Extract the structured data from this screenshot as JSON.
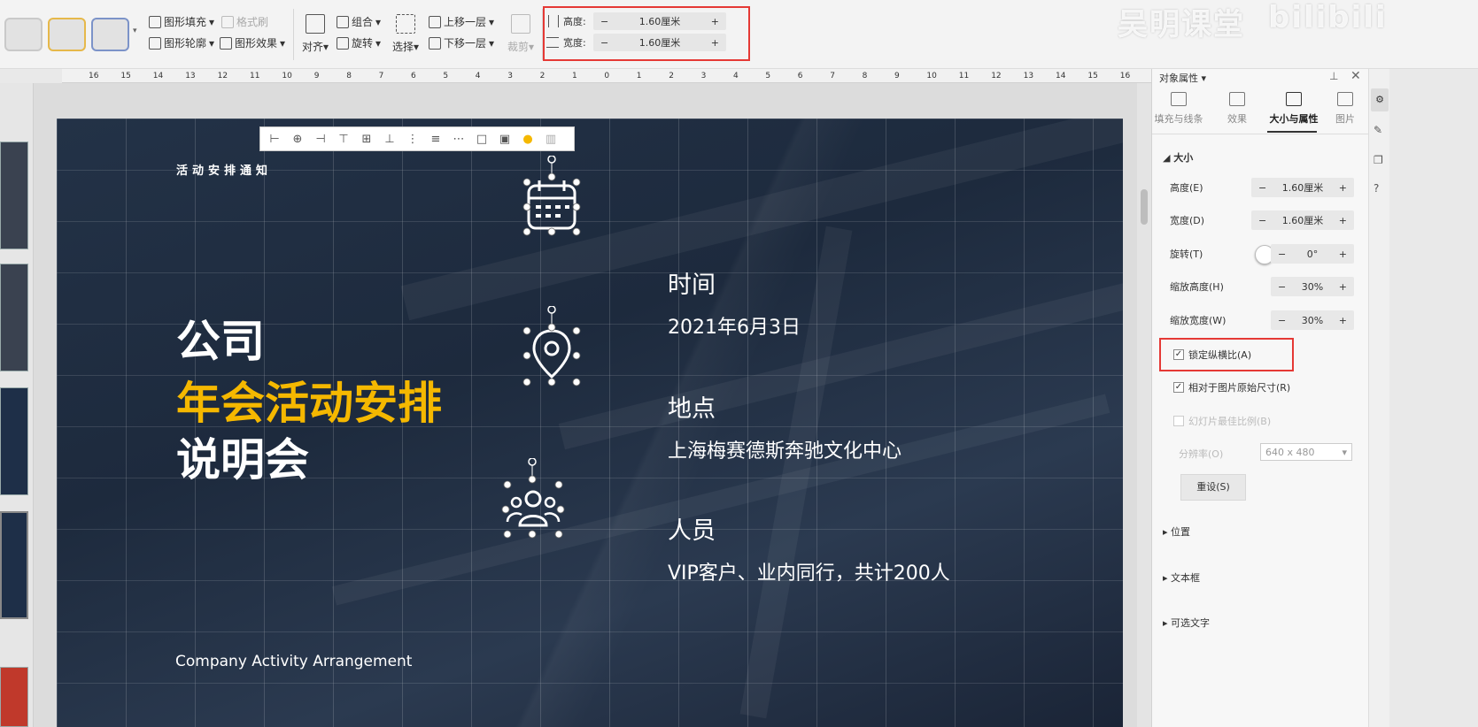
{
  "ribbon": {
    "shape_fill": "图形填充",
    "shape_outline": "图形轮廓",
    "format_painter": "格式刷",
    "shape_effect": "图形效果",
    "align": "对齐",
    "group": "组合",
    "rotate": "旋转",
    "select": "选择",
    "bring_forward": "上移一层",
    "send_backward": "下移一层",
    "crop": "裁剪",
    "height_label": "高度:",
    "height_value": "1.60厘米",
    "width_label": "宽度:",
    "width_value": "1.60厘米",
    "minus": "−",
    "plus": "+"
  },
  "watermark": {
    "text1": "吴明课堂",
    "text2": "bilibili"
  },
  "ruler": {
    "ticks": [
      "16",
      "15",
      "14",
      "13",
      "12",
      "11",
      "10",
      "9",
      "8",
      "7",
      "6",
      "5",
      "4",
      "3",
      "2",
      "1",
      "0",
      "1",
      "2",
      "3",
      "4",
      "5",
      "6",
      "7",
      "8",
      "9",
      "10",
      "11",
      "12",
      "13",
      "14",
      "15",
      "16"
    ]
  },
  "slide": {
    "eyebrow": "活动安排通知",
    "title_line1": "公司",
    "title_line2": "年会活动安排",
    "title_line3": "说明会",
    "footer": "Company Activity Arrangement",
    "time_heading": "时间",
    "time_value": "2021年6月3日",
    "place_heading": "地点",
    "place_value": "上海梅赛德斯奔驰文化中心",
    "people_heading": "人员",
    "people_value": "VIP客户、业内同行，共计200人",
    "accent_color": "#f5b800"
  },
  "panel": {
    "title": "对象属性",
    "tabs": [
      "填充与线条",
      "效果",
      "大小与属性",
      "图片"
    ],
    "active_tab": "大小与属性",
    "section_size": "大小",
    "height_label": "高度(E)",
    "height_value": "1.60厘米",
    "width_label": "宽度(D)",
    "width_value": "1.60厘米",
    "rotate_label": "旋转(T)",
    "rotate_value": "0°",
    "scale_h_label": "缩放高度(H)",
    "scale_h_value": "30%",
    "scale_w_label": "缩放宽度(W)",
    "scale_w_value": "30%",
    "lock_ratio": "锁定纵横比(A)",
    "relative_original": "相对于图片原始尺寸(R)",
    "best_scale": "幻灯片最佳比例(B)",
    "resolution_label": "分辨率(O)",
    "resolution_value": "640 x 480",
    "reset": "重设(S)",
    "section_position": "位置",
    "section_textbox": "文本框",
    "section_alt": "可选文字",
    "minus": "−",
    "plus": "+"
  }
}
